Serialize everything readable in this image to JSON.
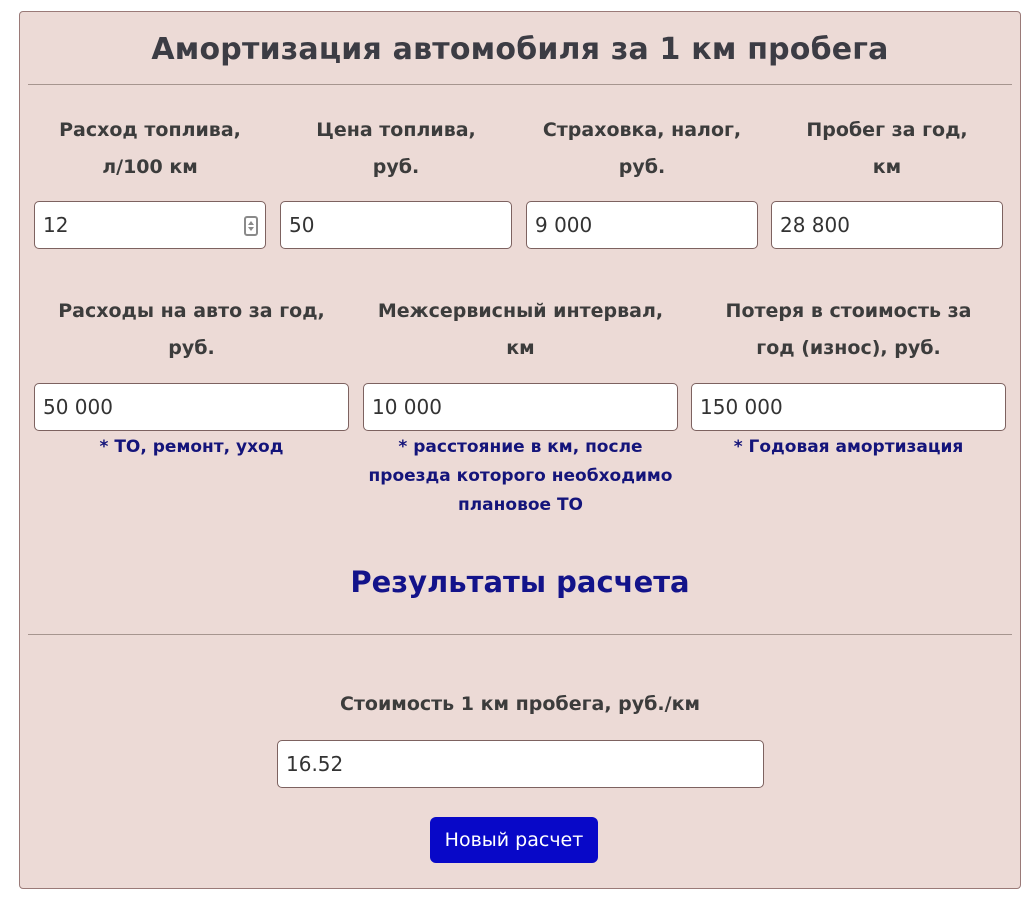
{
  "header": {
    "title": "Амортизация автомобиля за 1 км пробега"
  },
  "inputs_row1": [
    {
      "label_line1": "Расход топлива,",
      "label_line2": "л/100 км",
      "value": "12"
    },
    {
      "label_line1": "Цена топлива,",
      "label_line2": "руб.",
      "value": "50"
    },
    {
      "label_line1": "Страховка, налог,",
      "label_line2": "руб.",
      "value": "9 000"
    },
    {
      "label_line1": "Пробег за год,",
      "label_line2": "км",
      "value": "28 800"
    }
  ],
  "inputs_row2": [
    {
      "label_line1": "Расходы на авто за год,",
      "label_line2": "руб.",
      "value": "50 000",
      "note_lines": [
        "* ТО, ремонт, уход"
      ]
    },
    {
      "label_line1": "Межсервисный интервал,",
      "label_line2": "км",
      "value": "10 000",
      "note_lines": [
        "* расстояние в км, после",
        "проезда которого необходимо",
        "плановое ТО"
      ]
    },
    {
      "label_line1": "Потеря в стоимость за",
      "label_line2": "год (износ), руб.",
      "value": "150 000",
      "note_lines": [
        "* Годовая амортизация"
      ]
    }
  ],
  "results": {
    "title": "Результаты расчета",
    "cost_label": "Стоимость 1 км пробега, руб./км",
    "cost_value": "16.52",
    "new_calc_button": "Новый расчет"
  }
}
